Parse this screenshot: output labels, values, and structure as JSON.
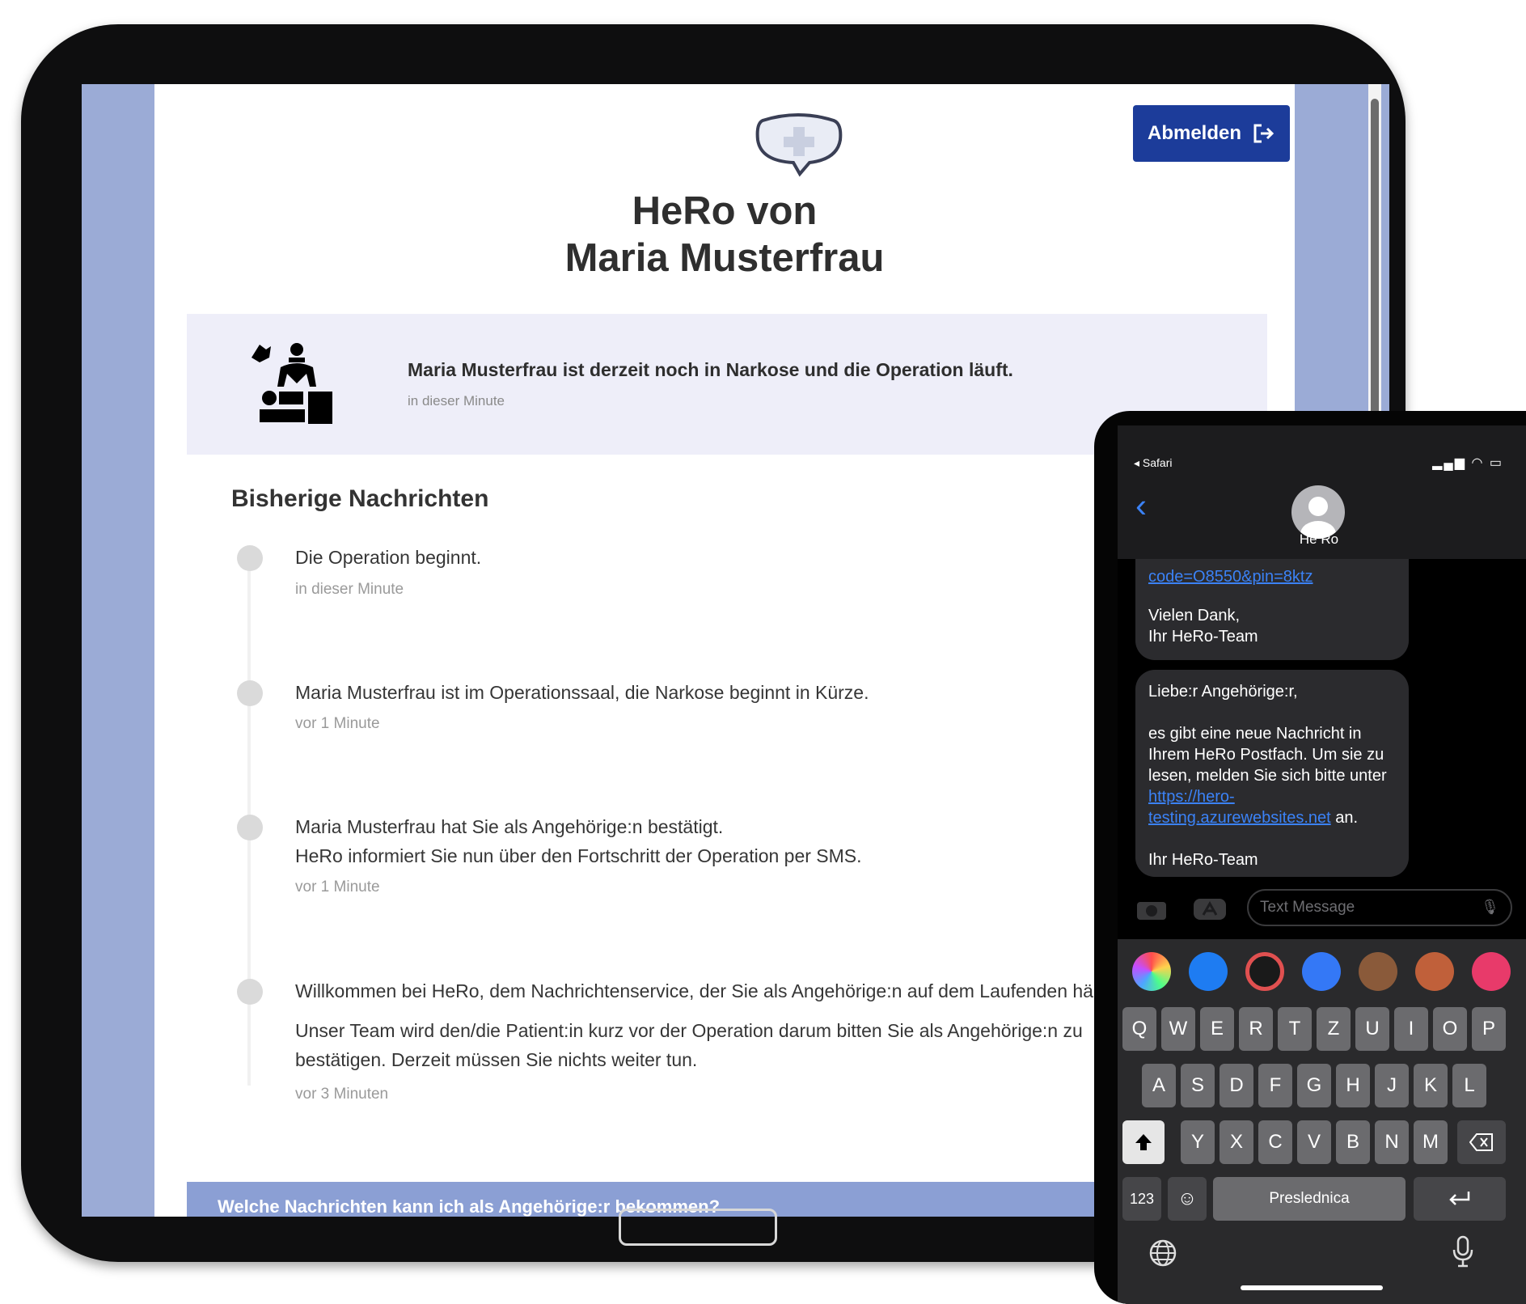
{
  "tablet": {
    "logout_label": "Abmelden",
    "title_line1": "HeRo von",
    "title_line2": "Maria Musterfrau",
    "status_text": "Maria Musterfrau ist derzeit noch in Narkose und die Operation läuft.",
    "status_time": "in dieser Minute",
    "section_title": "Bisherige Nachrichten",
    "messages": [
      {
        "lines": [
          "Die Operation beginnt."
        ],
        "time": "in dieser Minute"
      },
      {
        "lines": [
          "Maria Musterfrau ist im Operationssaal, die Narkose beginnt in Kürze."
        ],
        "time": "vor 1 Minute"
      },
      {
        "lines": [
          "Maria Musterfrau hat Sie als Angehörige:n bestätigt.",
          "HeRo informiert Sie nun über den Fortschritt der Operation per SMS."
        ],
        "time": "vor 1 Minute"
      },
      {
        "lines": [
          "Willkommen bei HeRo, dem Nachrichtenservice, der Sie als Angehörige:n auf dem Laufenden hält.",
          "Unser Team wird den/die Patient:in kurz vor der Operation darum bitten Sie als Angehörige:n zu",
          "bestätigen. Derzeit müssen Sie nichts weiter tun."
        ],
        "time": "vor 3 Minuten"
      }
    ],
    "faq_label": "Welche Nachrichten kann ich als Angehörige:r bekommen?"
  },
  "phone": {
    "back_app": "◂ Safari",
    "contact_name": "He Ro",
    "bubble1": {
      "link": "code=O8550&pin=8ktz",
      "line1": "Vielen Dank,",
      "line2": "Ihr HeRo-Team"
    },
    "bubble2": {
      "greeting": "Liebe:r Angehörige:r,",
      "body": "es gibt eine neue Nachricht in Ihrem HeRo Postfach. Um sie zu lesen, melden Sie sich bitte unter",
      "link": "https://hero-testing.azurewebsites.net",
      "after_link": "an.",
      "signoff": "Ihr HeRo-Team"
    },
    "input_placeholder": "Text Message",
    "keyboard": {
      "row1": [
        "Q",
        "W",
        "E",
        "R",
        "T",
        "Z",
        "U",
        "I",
        "O",
        "P"
      ],
      "row2": [
        "A",
        "S",
        "D",
        "F",
        "G",
        "H",
        "J",
        "K",
        "L"
      ],
      "row3": [
        "Y",
        "X",
        "C",
        "V",
        "B",
        "N",
        "M"
      ],
      "numbers_key": "123",
      "space_label": "Preslednica"
    }
  }
}
